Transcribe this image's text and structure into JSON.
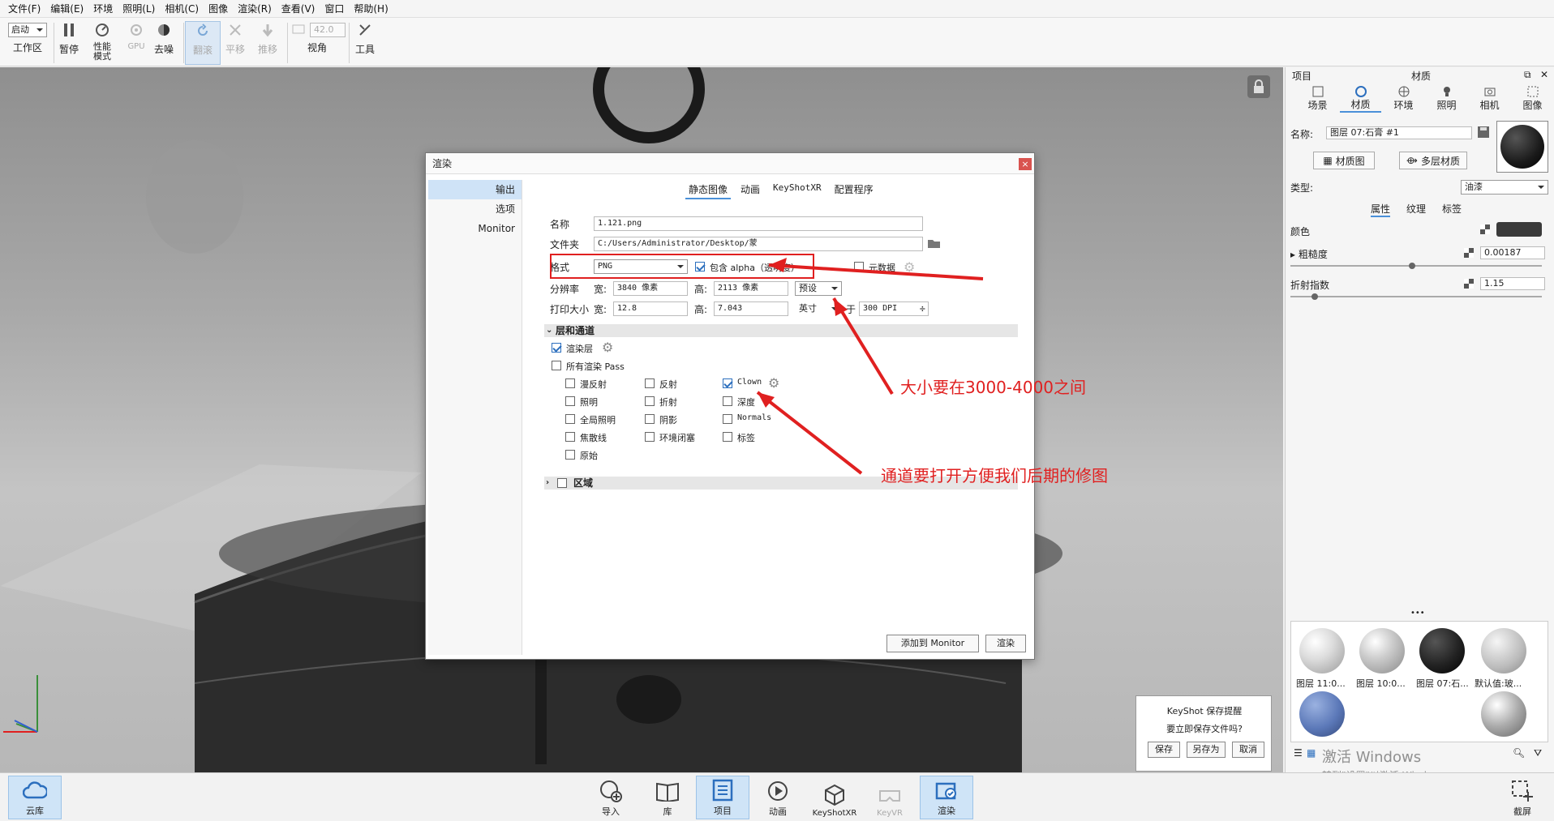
{
  "menubar": [
    "文件(F)",
    "编辑(E)",
    "环境",
    "照明(L)",
    "相机(C)",
    "图像",
    "渲染(R)",
    "查看(V)",
    "窗口",
    "帮助(H)"
  ],
  "toolbar": {
    "workspace_select": "启动",
    "workspace_label": "工作区",
    "pause": "暂停",
    "performance_mode": "性能\n模式",
    "gpu": "GPU",
    "denoise": "去噪",
    "flip": "翻滚",
    "pan": "平移",
    "push": "推移",
    "fov_value": "42.0",
    "view_angle": "视角",
    "tools": "工具"
  },
  "dialog": {
    "title": "渲染",
    "close": "×",
    "left_items": [
      "输出",
      "选项",
      "Monitor"
    ],
    "tabs": [
      "静态图像",
      "动画",
      "KeyShotXR",
      "配置程序"
    ],
    "name_label": "名称",
    "name_value": "1.121.png",
    "folder_label": "文件夹",
    "folder_value": "C:/Users/Administrator/Desktop/蒙",
    "format_label": "格式",
    "format_value": "PNG",
    "alpha_label": "包含 alpha（透明度）",
    "metadata_label": "元数据",
    "resolution_label": "分辨率",
    "width_label": "宽:",
    "width_value": "3840 像素",
    "height_label": "高:",
    "height_value": "2113 像素",
    "preset_label": "预设",
    "print_size_label": "打印大小",
    "print_width_label": "宽:",
    "print_width_value": "12.8",
    "print_height_label": "高:",
    "print_height_value": "7.043",
    "unit_value": "英寸",
    "at_label": "于",
    "dpi_value": "300 DPI",
    "layers_section": "层和通道",
    "render_layers": "渲染层",
    "all_passes": "所有渲染 Pass",
    "passes": [
      [
        "漫反射",
        "反射",
        "Clown"
      ],
      [
        "照明",
        "折射",
        "深度"
      ],
      [
        "全局照明",
        "阴影",
        "Normals"
      ],
      [
        "焦散线",
        "环境闭塞",
        "标签"
      ],
      [
        "原始"
      ]
    ],
    "region_section": "区域",
    "add_monitor": "添加到 Monitor",
    "render_button": "渲染"
  },
  "annotations": {
    "size_note": "大小要在3000-4000之间",
    "pass_note": "通道要打开方便我们后期的修图",
    "color": "#e02020"
  },
  "right_panel": {
    "header_left": "项目",
    "header_center": "材质",
    "tabs": [
      "场景",
      "材质",
      "环境",
      "照明",
      "相机",
      "图像"
    ],
    "name_label": "名称:",
    "name_value": "图层 07:石膏 #1",
    "material_graph": "材质图",
    "multi_material": "多层材质",
    "type_label": "类型:",
    "type_value": "油漆",
    "subtabs": [
      "属性",
      "纹理",
      "标签"
    ],
    "color_label": "颜色",
    "roughness_label": "粗糙度",
    "roughness_value": "0.00187",
    "ior_label": "折射指数",
    "ior_value": "1.15",
    "library_dots": "•••",
    "library_items": [
      "图层 11:0...",
      "图层 10:0...",
      "图层 07:石...",
      "默认值:玻..."
    ]
  },
  "reminder": {
    "title": "KeyShot 保存提醒",
    "question": "要立即保存文件吗?",
    "save": "保存",
    "save_as": "另存为",
    "cancel": "取消"
  },
  "watermark": {
    "line1": "激活 Windows",
    "line2": "转到\"设置\"以激活 Windows。"
  },
  "bottombar": {
    "cloud": "云库",
    "import": "导入",
    "library": "库",
    "project": "项目",
    "animation": "动画",
    "keyshotxr": "KeyShotXR",
    "keyvr": "KeyVR",
    "render": "渲染",
    "screenshot": "截屏"
  }
}
